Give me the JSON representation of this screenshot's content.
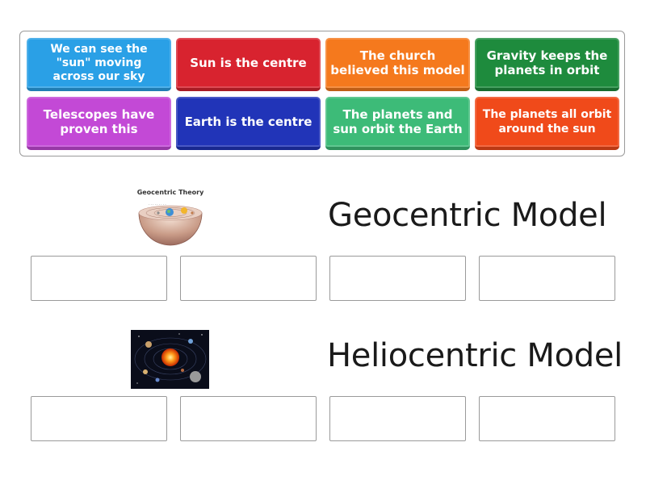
{
  "tiles": [
    {
      "label": "We can see the\n\"sun\" moving\nacross our sky",
      "color": "#2aa0e6"
    },
    {
      "label": "Sun is the centre",
      "color": "#d8232f"
    },
    {
      "label": "The church\nbelieved this model",
      "color": "#f5791d"
    },
    {
      "label": "Gravity keeps the\nplanets in orbit",
      "color": "#1e8b3d"
    },
    {
      "label": "Telescopes have\nproven this",
      "color": "#c349d6"
    },
    {
      "label": "Earth is the centre",
      "color": "#2134b8"
    },
    {
      "label": "The planets and\nsun orbit the Earth",
      "color": "#3dbb78"
    },
    {
      "label": "The planets all orbit\naround the sun",
      "color": "#f04a1a"
    }
  ],
  "groups": [
    {
      "heading": "Geocentric Model",
      "image_caption": "Geocentric Theory",
      "image": "geocentric-diagram"
    },
    {
      "heading": "Heliocentric Model",
      "image": "solar-system-photo"
    }
  ]
}
